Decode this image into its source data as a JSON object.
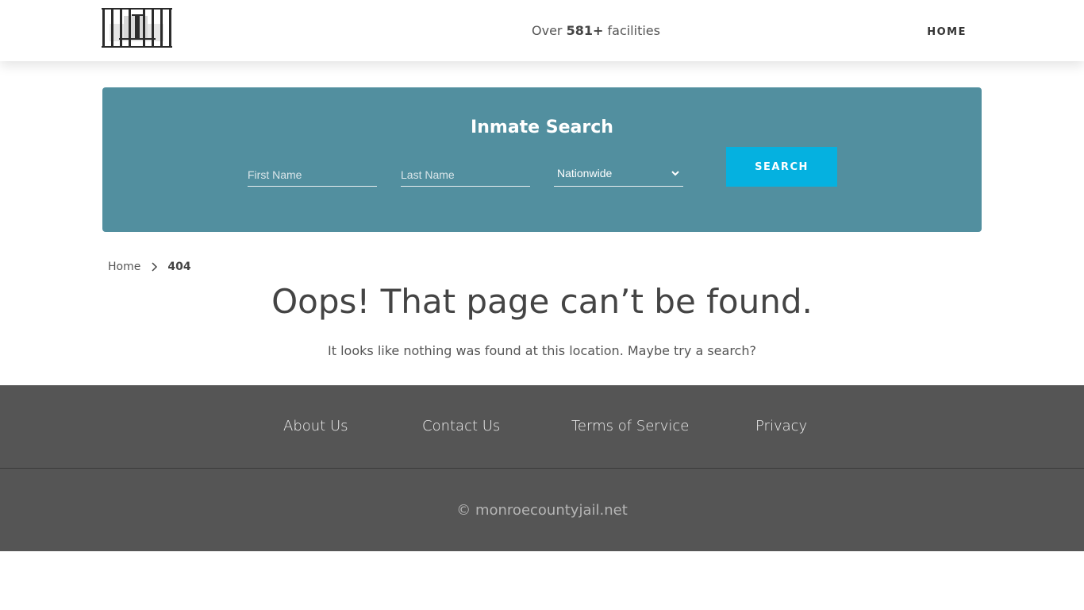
{
  "header": {
    "facilities_prefix": "Over",
    "facilities_count": "581+",
    "facilities_suffix": "facilities",
    "nav_home": "HOME"
  },
  "search": {
    "title": "Inmate Search",
    "first_name_placeholder": "First Name",
    "last_name_placeholder": "Last Name",
    "scope_value": "Nationwide",
    "button_label": "SEARCH"
  },
  "breadcrumb": {
    "home": "Home",
    "current": "404"
  },
  "error": {
    "title": "Oops! That page can’t be found.",
    "text": "It looks like nothing was found at this location. Maybe try a search?"
  },
  "footer": {
    "links": [
      "About Us",
      "Contact Us",
      "Terms of Service",
      "Privacy"
    ],
    "copyright": "© monroecountyjail.net"
  },
  "colors": {
    "search_panel": "#528f9f",
    "search_button": "#05b1e0",
    "footer": "#555555"
  },
  "icons": {
    "logo": "jail-bars-logo-icon",
    "select_arrow": "chevron-down-icon",
    "breadcrumb_separator": "chevron-right-icon"
  }
}
